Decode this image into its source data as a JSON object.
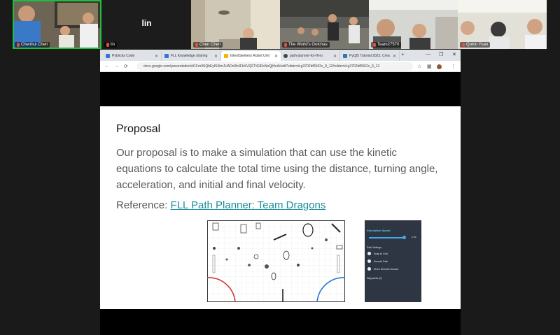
{
  "participants": [
    {
      "name": "Chenhui Chen",
      "active": true
    },
    {
      "name": "lin",
      "big_label": "lin"
    },
    {
      "name": "Chen Chen"
    },
    {
      "name": "The World's Gotchas"
    },
    {
      "name": "Team27570"
    },
    {
      "name": "Quinn Yuan"
    }
  ],
  "browser": {
    "tabs": [
      {
        "label": "Pybricks Code",
        "color": "#3a73d8"
      },
      {
        "label": "FLL Knowledge sharing",
        "color": "#3a73d8"
      },
      {
        "label": "IntentSeekers Robot Unit",
        "color": "#f4b400",
        "active": true
      },
      {
        "label": "path-planner-for-fll-ro",
        "color": "#444444"
      },
      {
        "label": "PyQt5 Tutorial 2023, Crea",
        "color": "#3776ab"
      }
    ],
    "new_tab": "+",
    "url": "docs.google.com/presentation/d/1Fm9SQbEyfS4lmJUADn0h4FbXVQFTtGlRcNnQjHuA/edit?slide=id.g3702bf5562c_9_12#slide=id.g3702bf5562c_9_12"
  },
  "slide": {
    "title": "Proposal",
    "body": "Our proposal is to make a simulation that can use the kinetic equations to calculate the total time using the distance, turning angle, acceleration, and initial and final velocity.",
    "reference_prefix": "Reference: ",
    "reference_link": "FLL Path Planner: Team Dragons"
  },
  "settings_panel": {
    "title": "Simulation Speed",
    "speed_value": "1.0x",
    "path_settings_label": "Path Settings",
    "options": [
      "Snap to Grid",
      "Smooth Path",
      "Show Direction Arrows"
    ],
    "waypoints_label": "Waypoints (0)"
  }
}
